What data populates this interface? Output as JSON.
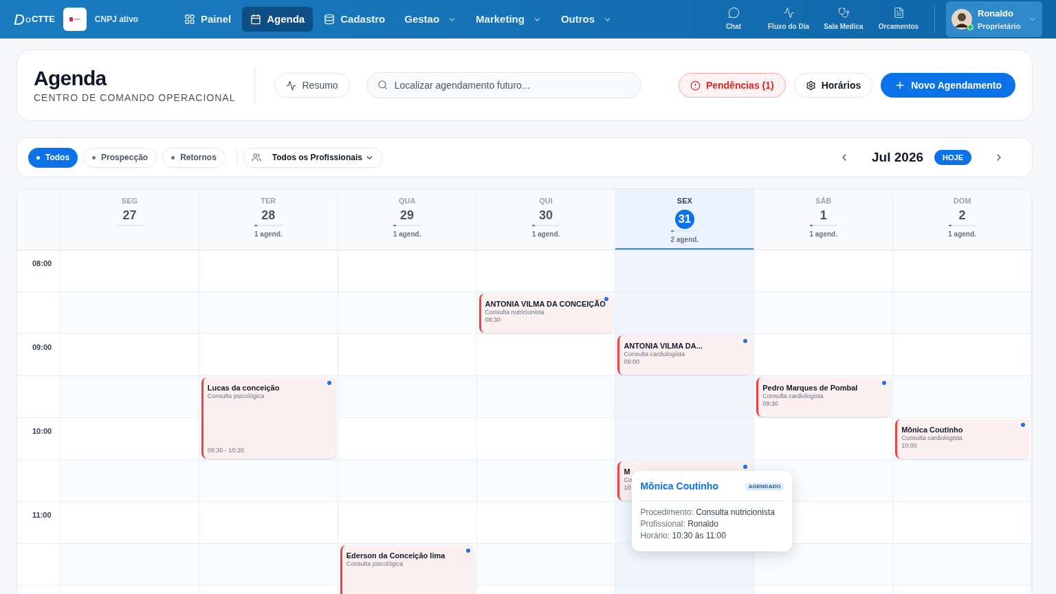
{
  "topbar": {
    "logo_start": "D",
    "logo_end": "CTTE",
    "company_status": "CNPJ ativo",
    "nav": [
      {
        "label": "Painel",
        "selected": false
      },
      {
        "label": "Agenda",
        "selected": true
      },
      {
        "label": "Cadastro",
        "selected": false
      },
      {
        "label": "Gestao",
        "selected": false
      },
      {
        "label": "Marketing",
        "selected": false
      },
      {
        "label": "Outros",
        "selected": false
      }
    ],
    "shortcuts": [
      {
        "label": "Chat"
      },
      {
        "label": "Fluxo do Dia"
      },
      {
        "label": "Sala Medica"
      },
      {
        "label": "Orcamentos"
      }
    ],
    "user": {
      "name": "Ronaldo",
      "role": "Proprietário",
      "online": true
    }
  },
  "header": {
    "title": "Agenda",
    "subtitle": "CENTRO DE COMANDO OPERACIONAL",
    "summary_button": "Resumo",
    "search": {
      "placeholder": "Localizar agendamento futuro..."
    },
    "pending_button": "Pendências (1)",
    "hours_button": "Horários",
    "new_button": "Novo Agendamento"
  },
  "filters": {
    "chips": [
      {
        "label": "Todos",
        "selected": true
      },
      {
        "label": "Prospecção",
        "selected": false
      },
      {
        "label": "Retornos",
        "selected": false
      }
    ],
    "professional": "Todos os Profissionais",
    "month": "Jul 2026",
    "today_button": "HOJE"
  },
  "calendar": {
    "times": [
      "08:00",
      "09:00",
      "10:00",
      "11:00"
    ],
    "days": [
      {
        "weekday": "SEG",
        "date": "27",
        "selected": false,
        "slots": [
          {
            "kind": "empty"
          },
          {
            "kind": "empty"
          },
          {
            "kind": "empty"
          },
          {
            "kind": "empty"
          },
          {
            "kind": "empty"
          },
          {
            "kind": "empty"
          },
          {
            "kind": "empty"
          },
          {
            "kind": "empty"
          },
          {
            "kind": "empty"
          }
        ]
      },
      {
        "weekday": "TER",
        "date": "28",
        "count": "1 agend.",
        "selected": false,
        "slots": [
          {
            "kind": "empty"
          },
          {
            "kind": "empty"
          },
          {
            "kind": "empty"
          },
          {
            "kind": "tall",
            "name": "Lucas da conceição",
            "service": "Consulta psicológica",
            "time": "09:30 - 10:20"
          },
          {
            "kind": "covered"
          },
          {
            "kind": "empty"
          },
          {
            "kind": "empty"
          },
          {
            "kind": "empty"
          },
          {
            "kind": "empty"
          }
        ]
      },
      {
        "weekday": "QUA",
        "date": "29",
        "count": "1 agend.",
        "selected": false,
        "slots": [
          {
            "kind": "empty"
          },
          {
            "kind": "empty"
          },
          {
            "kind": "empty"
          },
          {
            "kind": "empty"
          },
          {
            "kind": "empty"
          },
          {
            "kind": "empty"
          },
          {
            "kind": "empty"
          },
          {
            "kind": "tall",
            "name": "Ederson da Conceição lima",
            "service": "Consulta psicológica"
          },
          {
            "kind": "covered"
          }
        ]
      },
      {
        "weekday": "QUI",
        "date": "30",
        "count": "1 agend.",
        "selected": false,
        "slots": [
          {
            "kind": "empty"
          },
          {
            "kind": "event",
            "name": "ANTONIA VILMA DA CONCEIÇÃO",
            "service": "Consulta nutricionista",
            "time": "08:30"
          },
          {
            "kind": "empty"
          },
          {
            "kind": "empty"
          },
          {
            "kind": "empty"
          },
          {
            "kind": "empty"
          },
          {
            "kind": "empty"
          },
          {
            "kind": "empty"
          },
          {
            "kind": "empty"
          }
        ]
      },
      {
        "weekday": "SEX",
        "date": "31",
        "count": "2 agend.",
        "selected": true,
        "slots": [
          {
            "kind": "empty"
          },
          {
            "kind": "empty"
          },
          {
            "kind": "event",
            "name": "ANTONIA VILMA DA...",
            "service": "Consulta cardiologista",
            "time": "09:00"
          },
          {
            "kind": "empty"
          },
          {
            "kind": "empty"
          },
          {
            "kind": "event",
            "name": "M",
            "service": "Co",
            "time": "10"
          },
          {
            "kind": "empty"
          },
          {
            "kind": "empty"
          },
          {
            "kind": "empty"
          }
        ]
      },
      {
        "weekday": "SÁB",
        "date": "1",
        "count": "1 agend.",
        "selected": false,
        "slots": [
          {
            "kind": "empty"
          },
          {
            "kind": "empty"
          },
          {
            "kind": "empty"
          },
          {
            "kind": "event",
            "name": "Pedro Marques de Pombal",
            "service": "Consulta cardiologista",
            "time": "09:30"
          },
          {
            "kind": "empty"
          },
          {
            "kind": "empty"
          },
          {
            "kind": "empty"
          },
          {
            "kind": "empty"
          },
          {
            "kind": "empty"
          }
        ]
      },
      {
        "weekday": "DOM",
        "date": "2",
        "count": "1 agend.",
        "selected": false,
        "slots": [
          {
            "kind": "empty"
          },
          {
            "kind": "empty"
          },
          {
            "kind": "empty"
          },
          {
            "kind": "empty"
          },
          {
            "kind": "event",
            "name": "Mônica Coutinho",
            "service": "Consulta cardiologista",
            "time": "10:00"
          },
          {
            "kind": "empty"
          },
          {
            "kind": "empty"
          },
          {
            "kind": "empty"
          },
          {
            "kind": "empty"
          }
        ]
      }
    ],
    "popover": {
      "name": "Mônica Coutinho",
      "status": "AGENDADO",
      "lines": [
        {
          "label": "Procedimento:",
          "value": "Consulta nutricionista"
        },
        {
          "label": "Profissional:",
          "value": "Ronaldo"
        },
        {
          "label": "Horário:",
          "value": "10:30 às 11:00"
        }
      ]
    }
  }
}
